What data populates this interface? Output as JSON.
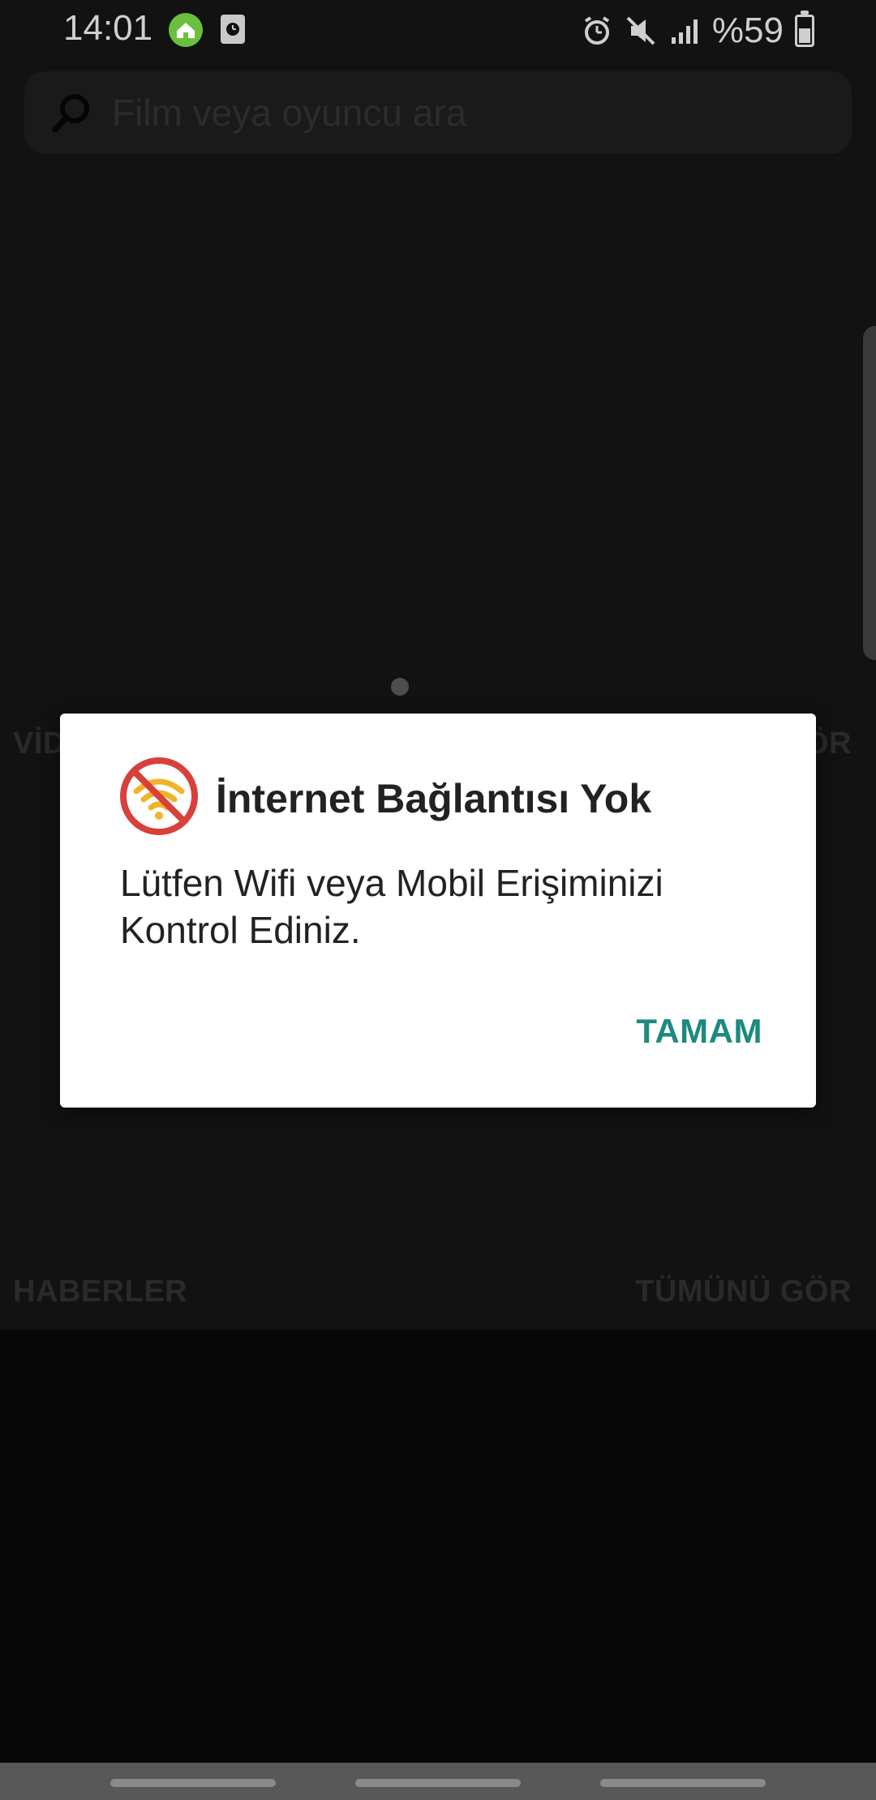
{
  "status_bar": {
    "time": "14:01",
    "battery_text": "%59",
    "icons": [
      "home-app-icon",
      "clock-app-icon",
      "alarm-icon",
      "mute-icon",
      "signal-icon",
      "battery-charging-icon"
    ]
  },
  "search": {
    "placeholder": "Film veya oyuncu ara",
    "icon": "search-icon"
  },
  "sections": {
    "videos_label": "VİDEOLAR",
    "videos_see_all": "TÜMÜNÜ GÖR",
    "news_label": "HABERLER",
    "news_see_all": "TÜMÜNÜ GÖR"
  },
  "dialog": {
    "icon": "no-wifi-icon",
    "title": "İnternet Bağlantısı Yok",
    "message": "Lütfen Wifi veya Mobil Erişiminizi Kontrol Ediniz.",
    "ok_label": "TAMAM"
  },
  "colors": {
    "accent": "#1c8a7e",
    "no_wifi_red": "#d9403a",
    "wifi_yellow": "#f0b429",
    "status_app_green": "#6bbf3d"
  }
}
